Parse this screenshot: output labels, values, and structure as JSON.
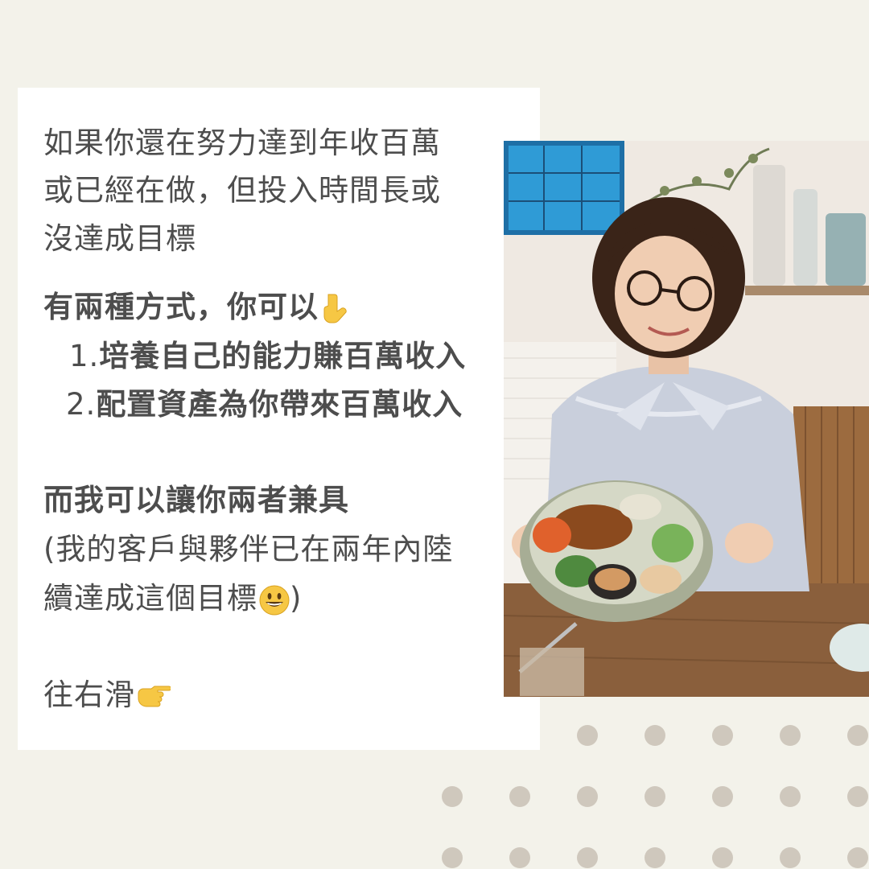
{
  "intro": {
    "line1": "如果你還在努力達到年收百萬",
    "line2": "或已經在做，但投入時間長或",
    "line3": "沒達成目標"
  },
  "ways": {
    "heading": "有兩種方式，你可以",
    "heading_icon": "pointing-down-hand-emoji",
    "items": [
      {
        "number": "1.",
        "label": "培養自己的能力賺百萬收入"
      },
      {
        "number": "2.",
        "label": "配置資產為你帶來百萬收入"
      }
    ]
  },
  "offer": {
    "heading": "而我可以讓你兩者兼具",
    "note_line1": "(我的客戶與夥伴已在兩年內陸",
    "note_line2": "續達成這個目標",
    "note_close": ")",
    "note_icon": "grinning-face-emoji"
  },
  "cta": {
    "label": "往右滑",
    "icon": "pointing-right-hand-emoji"
  },
  "colors": {
    "background": "#f3f2ea",
    "card": "#ffffff",
    "text": "#4d4d4d",
    "dots": "#cfc8bd",
    "emoji": "#f6c744"
  }
}
